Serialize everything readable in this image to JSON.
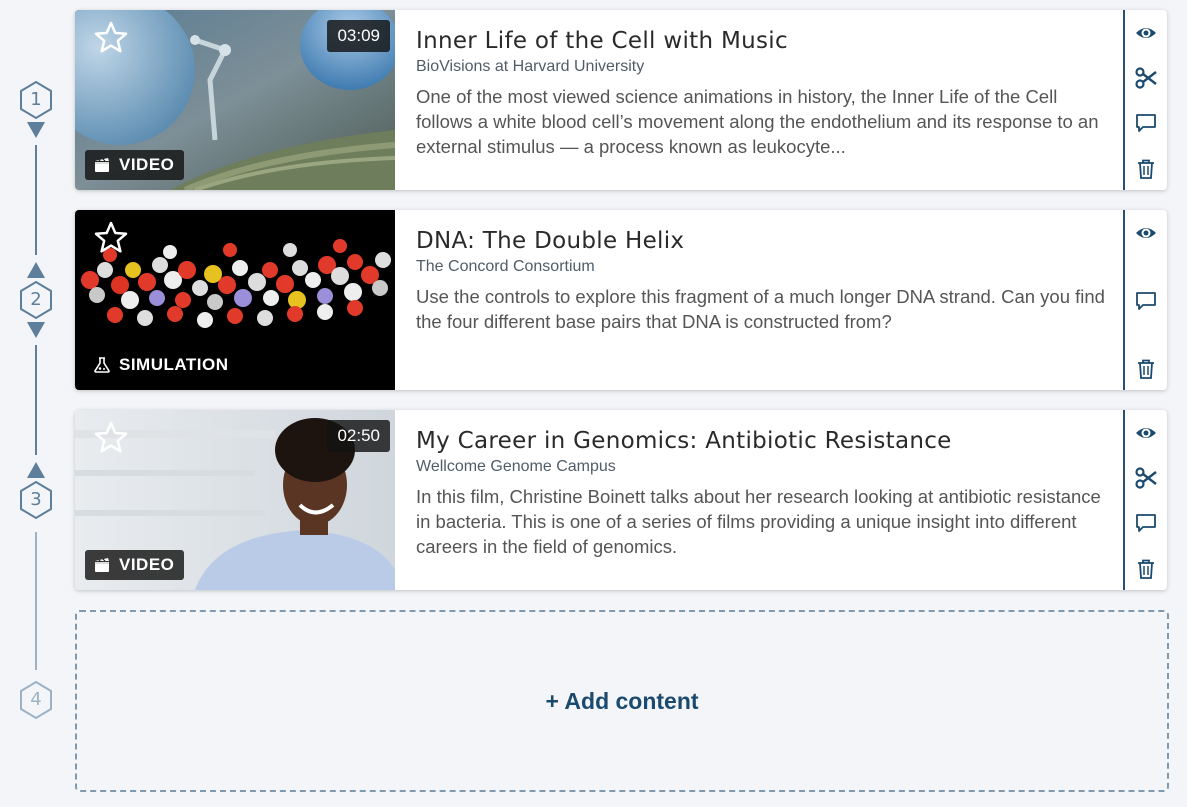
{
  "steps": [
    "1",
    "2",
    "3",
    "4"
  ],
  "cards": [
    {
      "title": "Inner Life of the Cell with Music",
      "source": "BioVisions at Harvard University",
      "description": "One of the most viewed science animations in history, the Inner Life of the Cell follows a white blood cell’s movement along the endothelium and its response to an external stimulus — a process known as leukocyte...",
      "duration": "03:09",
      "type": "VIDEO",
      "actions": [
        "eye-icon",
        "scissors-icon",
        "comment-icon",
        "trash-icon"
      ]
    },
    {
      "title": "DNA: The Double Helix",
      "source": "The Concord Consortium",
      "description": "Use the controls to explore this fragment of a much longer DNA strand. Can you find the four different base pairs that DNA is constructed from?",
      "duration": "",
      "type": "SIMULATION",
      "actions": [
        "eye-icon",
        "comment-icon",
        "trash-icon"
      ]
    },
    {
      "title": "My Career in Genomics: Antibiotic Resistance",
      "source": "Wellcome Genome Campus",
      "description": "In this film, Christine Boinett talks about her research looking at antibiotic resistance in bacteria. This is one of a series of films providing a unique insight into different careers in the field of genomics.",
      "duration": "02:50",
      "type": "VIDEO",
      "actions": [
        "eye-icon",
        "scissors-icon",
        "comment-icon",
        "trash-icon"
      ]
    }
  ],
  "add_content": {
    "label": "+ Add content"
  },
  "colors": {
    "accent": "#1b4a6e",
    "rail": "#5d7f9c",
    "background": "#f3f5f8"
  }
}
